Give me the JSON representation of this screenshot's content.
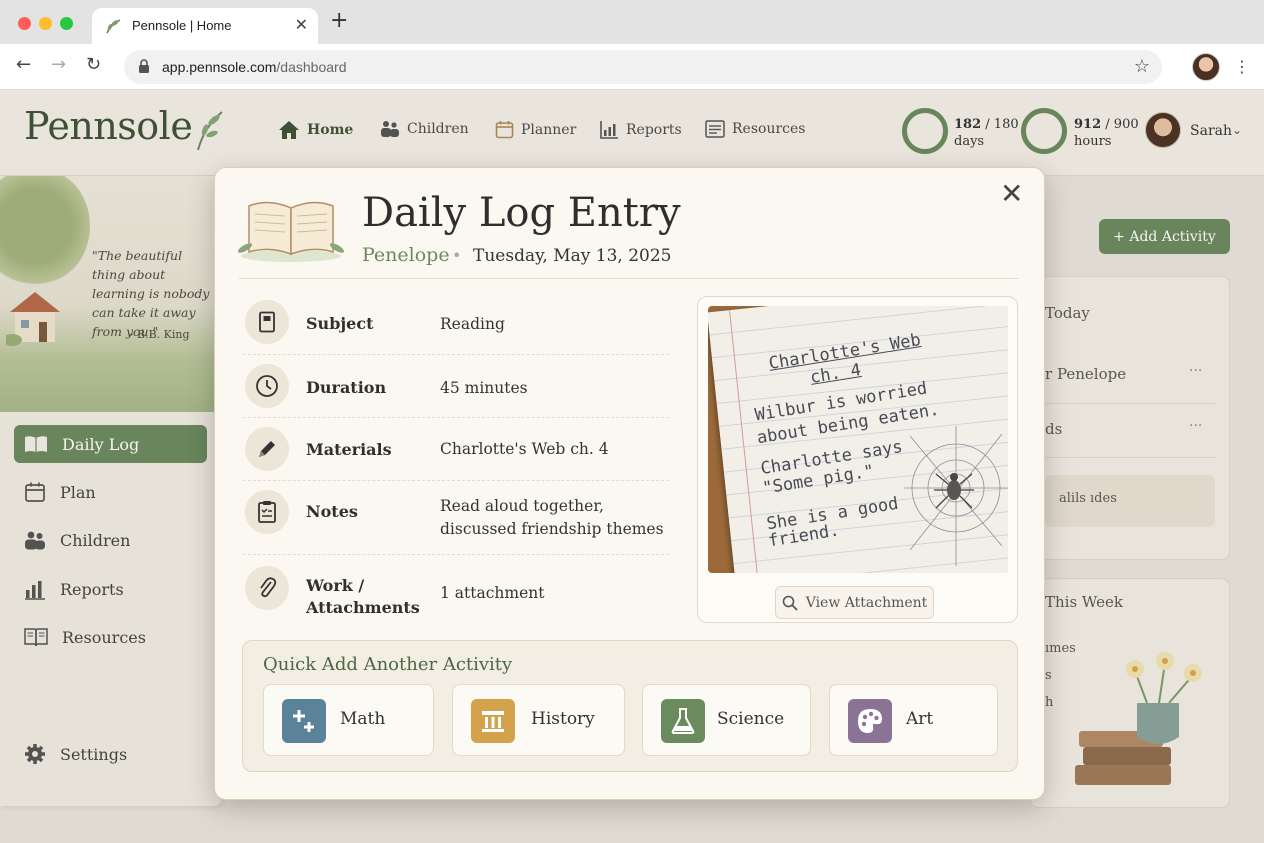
{
  "browser": {
    "tab_title": "Pennsole | Home",
    "url_host": "app.pennsole.com",
    "url_path": "/dashboard"
  },
  "header": {
    "logo": "Pennsole",
    "nav": [
      {
        "label": "Home",
        "icon": "home-icon",
        "active": true
      },
      {
        "label": "Children",
        "icon": "children-icon"
      },
      {
        "label": "Planner",
        "icon": "calendar-icon"
      },
      {
        "label": "Reports",
        "icon": "chart-icon"
      },
      {
        "label": "Resources",
        "icon": "list-icon"
      }
    ],
    "days_done": "182",
    "days_total": "/ 180",
    "days_unit": "days",
    "hours_done": "912",
    "hours_total": "/ 900",
    "hours_unit": "hours",
    "user_name": "Sarah"
  },
  "sidebar": {
    "quote": "\"The beautiful thing about learning is nobody can take it away from you.\"",
    "quote_author": "– B.B. King",
    "items": [
      {
        "label": "Daily Log",
        "icon": "book-icon",
        "active": true
      },
      {
        "label": "Plan",
        "icon": "calendar-icon"
      },
      {
        "label": "Children",
        "icon": "children-icon"
      },
      {
        "label": "Reports",
        "icon": "chart-icon"
      },
      {
        "label": "Resources",
        "icon": "resources-icon"
      }
    ],
    "settings": "Settings"
  },
  "right_panel": {
    "add_activity": "+ Add Activity",
    "today_title": "Today",
    "today_item_1": "r Penelope",
    "today_item_2": "ds",
    "today_pill": "alils ıdes",
    "week_title": "This Week",
    "week_line_1": "ımes",
    "week_line_2": "s",
    "week_line_3": "h"
  },
  "modal": {
    "title": "Daily Log Entry",
    "child": "Penelope",
    "date": "Tuesday, May 13, 2025",
    "fields": [
      {
        "label": "Subject",
        "value": "Reading",
        "icon": "notebook-icon"
      },
      {
        "label": "Duration",
        "value": "45 minutes",
        "icon": "clock-icon"
      },
      {
        "label": "Materials",
        "value": "Charlotte's Web ch. 4",
        "icon": "pencil-icon"
      },
      {
        "label": "Notes",
        "value": "Read aloud together, discussed friendship themes",
        "icon": "clipboard-icon"
      },
      {
        "label": "Work / Attachments",
        "value": "1 attachment",
        "icon": "paperclip-icon"
      }
    ],
    "attachment": {
      "lines": [
        "Charlotte's Web",
        "ch. 4",
        "Wilbur is worried",
        "about being eaten.",
        "Charlotte says",
        "\"Some pig.\"",
        "She is a good",
        "friend."
      ],
      "view_label": "View Attachment"
    },
    "quick_add": {
      "title": "Quick Add Another Activity",
      "items": [
        {
          "label": "Math",
          "icon": "math-icon",
          "color": "#5a8299"
        },
        {
          "label": "History",
          "icon": "pillar-icon",
          "color": "#d3a24a"
        },
        {
          "label": "Science",
          "icon": "flask-icon",
          "color": "#6b8a5e"
        },
        {
          "label": "Art",
          "icon": "palette-icon",
          "color": "#8b7396"
        }
      ]
    }
  },
  "colors": {
    "accent_green": "#6b8a5e",
    "logo_green": "#3f5236",
    "cream": "#fbf8f1"
  }
}
